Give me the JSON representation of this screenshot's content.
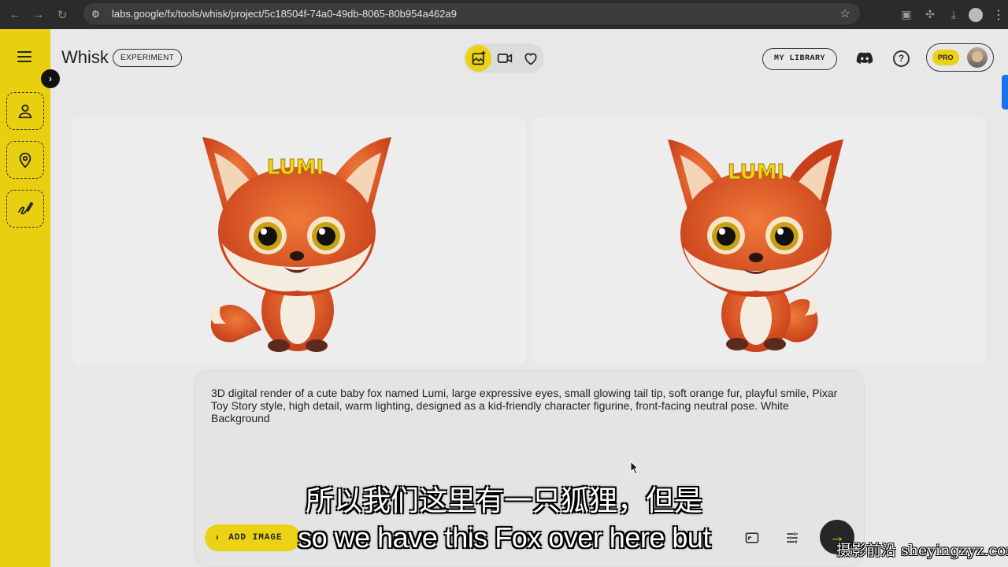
{
  "browser": {
    "url": "labs.google/fx/tools/whisk/project/5c18504f-74a0-49db-8065-80b954a462a9",
    "nav_icons": [
      "back-arrow-icon",
      "forward-arrow-icon",
      "reload-icon"
    ],
    "right_icons": [
      "extension-icon",
      "puzzle-icon",
      "download-icon",
      "profile-avatar",
      "more-menu-icon"
    ]
  },
  "app": {
    "brand": "Whisk",
    "badge": "EXPERIMENT",
    "sidebar_tools": [
      "subject-icon",
      "scene-icon",
      "style-icon"
    ],
    "modes": [
      "image-mode-icon",
      "video-mode-icon",
      "favorites-heart-icon"
    ],
    "active_mode": 0,
    "library_label": "MY LIBRARY",
    "pro_label": "PRO"
  },
  "gallery": {
    "images": [
      {
        "label": "LUMI",
        "subject": "cartoon fox character"
      },
      {
        "label": "LUMI",
        "subject": "cartoon fox character"
      }
    ]
  },
  "prompt": {
    "text": "3D digital render of a cute baby fox named Lumi, large expressive eyes, small glowing tail tip, soft orange fur, playful smile, Pixar Toy Story style, high detail, warm lighting, designed as a kid-friendly character figurine, front-facing neutral pose. White Background",
    "add_image_label": "ADD IMAGE"
  },
  "subtitles": {
    "chinese": "所以我们这里有一只狐狸，但是",
    "english": "so we have this Fox over here but"
  },
  "watermark": "摄影前沿 sheyingzyz.com",
  "colors": {
    "accent_yellow": "#ecd215",
    "sidebar_yellow": "#e8cf10",
    "fox_orange": "#e0541c"
  }
}
